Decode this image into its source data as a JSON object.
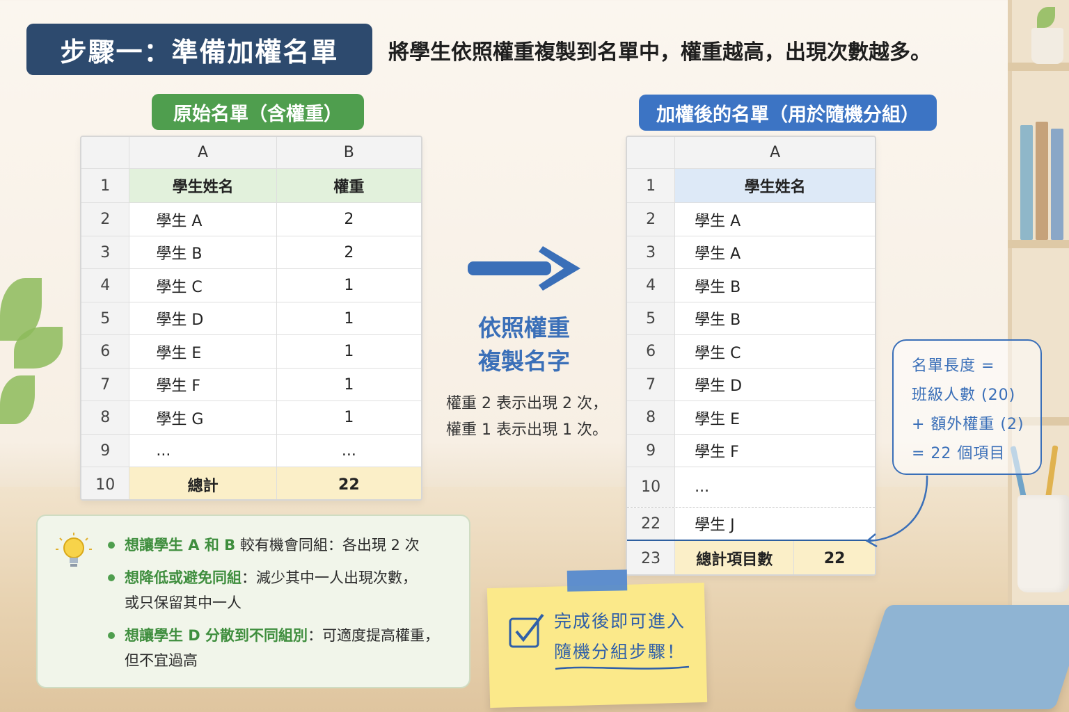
{
  "header": {
    "step_title": "步驟一：準備加權名單",
    "description": "將學生依照權重複製到名單中，權重越高，出現次數越多。"
  },
  "left_table": {
    "label": "原始名單（含權重）",
    "col_headers": [
      "A",
      "B"
    ],
    "rows": [
      {
        "n": "1",
        "a": "學生姓名",
        "b": "權重"
      },
      {
        "n": "2",
        "a": "學生 A",
        "b": "2"
      },
      {
        "n": "3",
        "a": "學生 B",
        "b": "2"
      },
      {
        "n": "4",
        "a": "學生 C",
        "b": "1"
      },
      {
        "n": "5",
        "a": "學生 D",
        "b": "1"
      },
      {
        "n": "6",
        "a": "學生 E",
        "b": "1"
      },
      {
        "n": "7",
        "a": "學生 F",
        "b": "1"
      },
      {
        "n": "8",
        "a": "學生 G",
        "b": "1"
      },
      {
        "n": "9",
        "a": "...",
        "b": "..."
      },
      {
        "n": "10",
        "a": "總計",
        "b": "22"
      }
    ]
  },
  "middle": {
    "title_line1": "依照權重",
    "title_line2": "複製名字",
    "note_line1": "權重 2 表示出現 2 次，",
    "note_line2": "權重 1 表示出現 1 次。"
  },
  "right_table": {
    "label": "加權後的名單（用於隨機分組）",
    "col_headers": [
      "A"
    ],
    "rows": [
      {
        "n": "1",
        "a": "學生姓名"
      },
      {
        "n": "2",
        "a": "學生 A"
      },
      {
        "n": "3",
        "a": "學生 A"
      },
      {
        "n": "4",
        "a": "學生 B"
      },
      {
        "n": "5",
        "a": "學生 B"
      },
      {
        "n": "6",
        "a": "學生 C"
      },
      {
        "n": "7",
        "a": "學生 D"
      },
      {
        "n": "8",
        "a": "學生 E"
      },
      {
        "n": "9",
        "a": "學生 F"
      },
      {
        "n": "10",
        "a": "..."
      },
      {
        "n": "22",
        "a": "學生 J"
      }
    ],
    "total_row": {
      "n": "23",
      "label": "總計項目數",
      "value": "22"
    }
  },
  "annotation": {
    "line1": "名單長度 =",
    "line2": "班級人數 (20)",
    "line3": "+ 額外權重 (2)",
    "line4": "= 22 個項目"
  },
  "tips": [
    {
      "highlight": "想讓學生 A 和 B",
      "text": " 較有機會同組：各出現 2 次",
      "text2": ""
    },
    {
      "highlight": "想降低或避免同組",
      "text": "：減少其中一人出現次數，",
      "text2": "或只保留其中一人"
    },
    {
      "highlight": "想讓學生 D 分散到不同組別",
      "text": "：可適度提高權重，",
      "text2": "但不宜過高"
    }
  ],
  "sticky_note": {
    "line1": "完成後即可進入",
    "line2": "隨機分組步驟！"
  },
  "colors": {
    "title_bg": "#2d4a6e",
    "green_accent": "#4f9e4e",
    "blue_accent": "#3c74c4",
    "yellow_fill": "#fbefc8"
  }
}
